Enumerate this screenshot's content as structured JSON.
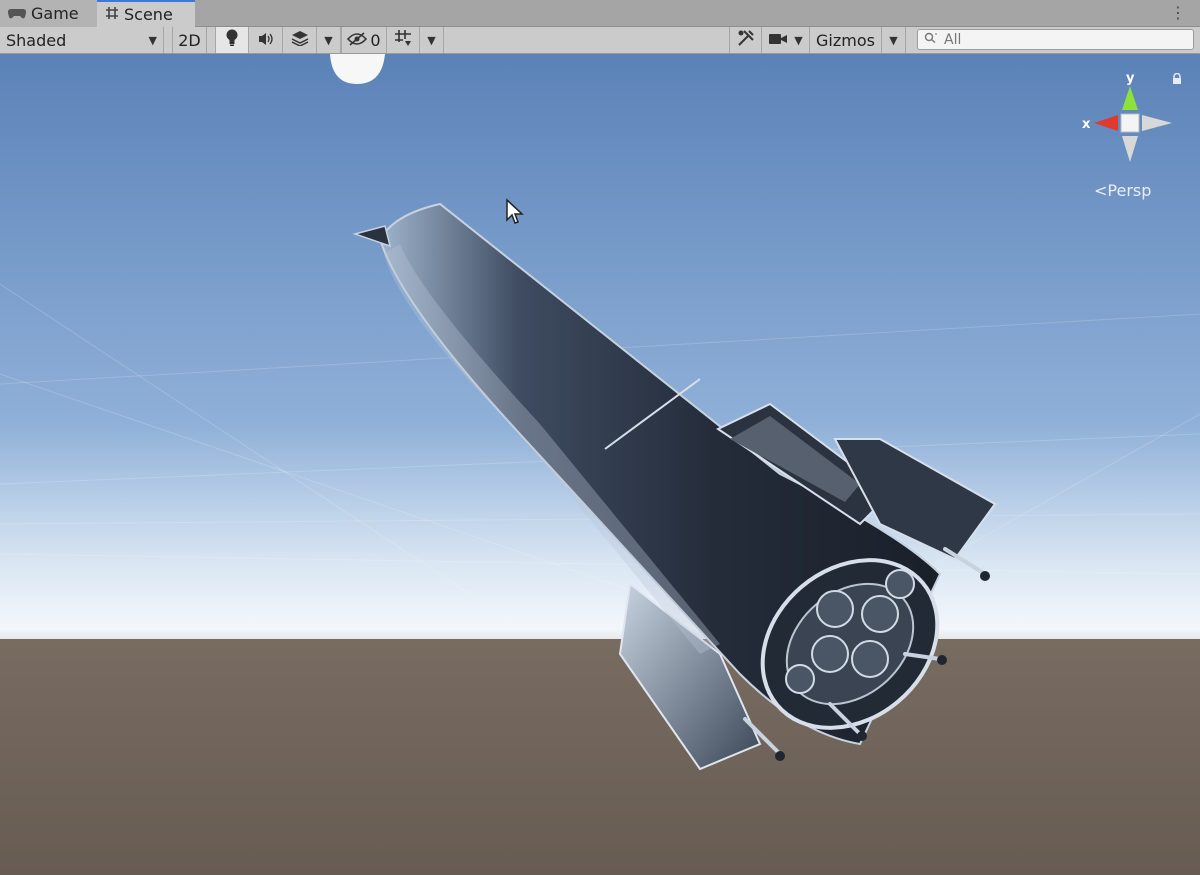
{
  "tabs": [
    {
      "label": "Game",
      "icon": "gamepad-icon"
    },
    {
      "label": "Scene",
      "icon": "grid-icon"
    }
  ],
  "toolbar": {
    "shading_mode": "Shaded",
    "btn_2d": "2D",
    "hidden_count": "0",
    "gizmos_label": "Gizmos",
    "search_placeholder": "All"
  },
  "scene_gizmo": {
    "y_label": "y",
    "x_label": "x",
    "projection": "Persp"
  },
  "colors": {
    "accent": "#3a79d8",
    "x_axis": "#e03a2e",
    "y_axis": "#8ee03a",
    "sky_top": "#5f87bd",
    "ground": "#6d6259"
  }
}
